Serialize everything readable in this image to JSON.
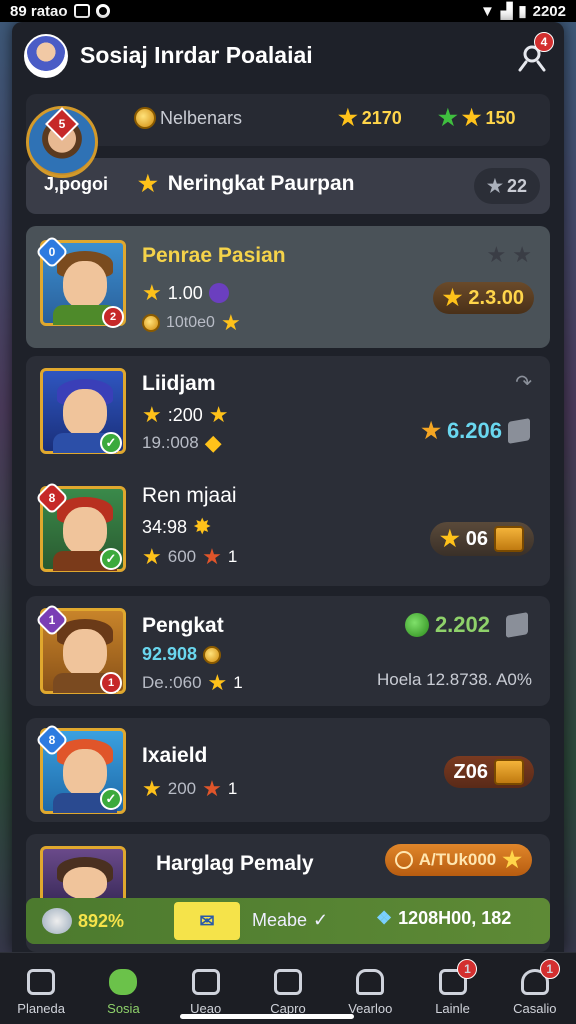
{
  "status": {
    "left_text": "89 ratao",
    "time": "2202"
  },
  "header": {
    "title": "Sosiaj Inrdar Poalaiai",
    "notif_count": "4"
  },
  "stats": {
    "label": "Nelbenars",
    "stars_value": "2170",
    "green_value": "150"
  },
  "player": {
    "rank_badge": "5",
    "name": "J,pogoi",
    "rank_title": "Neringkat Paurpan",
    "rank_points": "22"
  },
  "entries": [
    {
      "name": "Penrae Pasian",
      "line1": "1.00",
      "line2": "10t0e0",
      "score": "2.3.00",
      "badge": "0",
      "mark": "2"
    },
    {
      "name": "Liidjam",
      "line1": ":200",
      "line2": "19.:008",
      "score": "6.206"
    },
    {
      "name": "Ren mjaai",
      "line1": "34:98",
      "line2": "600",
      "line2_suffix": "1",
      "score": "06",
      "badge": "8"
    },
    {
      "name": "Pengkat",
      "line1": "92.908",
      "line2": "De.:060",
      "line2_suffix": "1",
      "score": "2.202",
      "extra": "Hoela 12.8738. A0%",
      "badge": "1",
      "mark": "1"
    },
    {
      "name": "Ixaield",
      "line2": "200",
      "line2_suffix": "1",
      "score": "Z06",
      "badge": "8"
    },
    {
      "name": "Harglag Pemaly",
      "cta": "A/TUk000"
    }
  ],
  "bottom_strip": {
    "left": "892%",
    "middle": "Meabe",
    "right": "1208H00, 182"
  },
  "tabs": [
    {
      "label": "Planeda"
    },
    {
      "label": "Sosia"
    },
    {
      "label": "Ueao"
    },
    {
      "label": "Capro"
    },
    {
      "label": "Vearloo"
    },
    {
      "label": "Lainle",
      "badge": "1"
    },
    {
      "label": "Casalio",
      "badge": "1"
    }
  ],
  "colors": {
    "panel": "#1e2129",
    "accent_green": "#6bc24a",
    "gold": "#ffc21a",
    "highlight_text": "#f5d34a",
    "cyan_score": "#6ad7ef"
  }
}
